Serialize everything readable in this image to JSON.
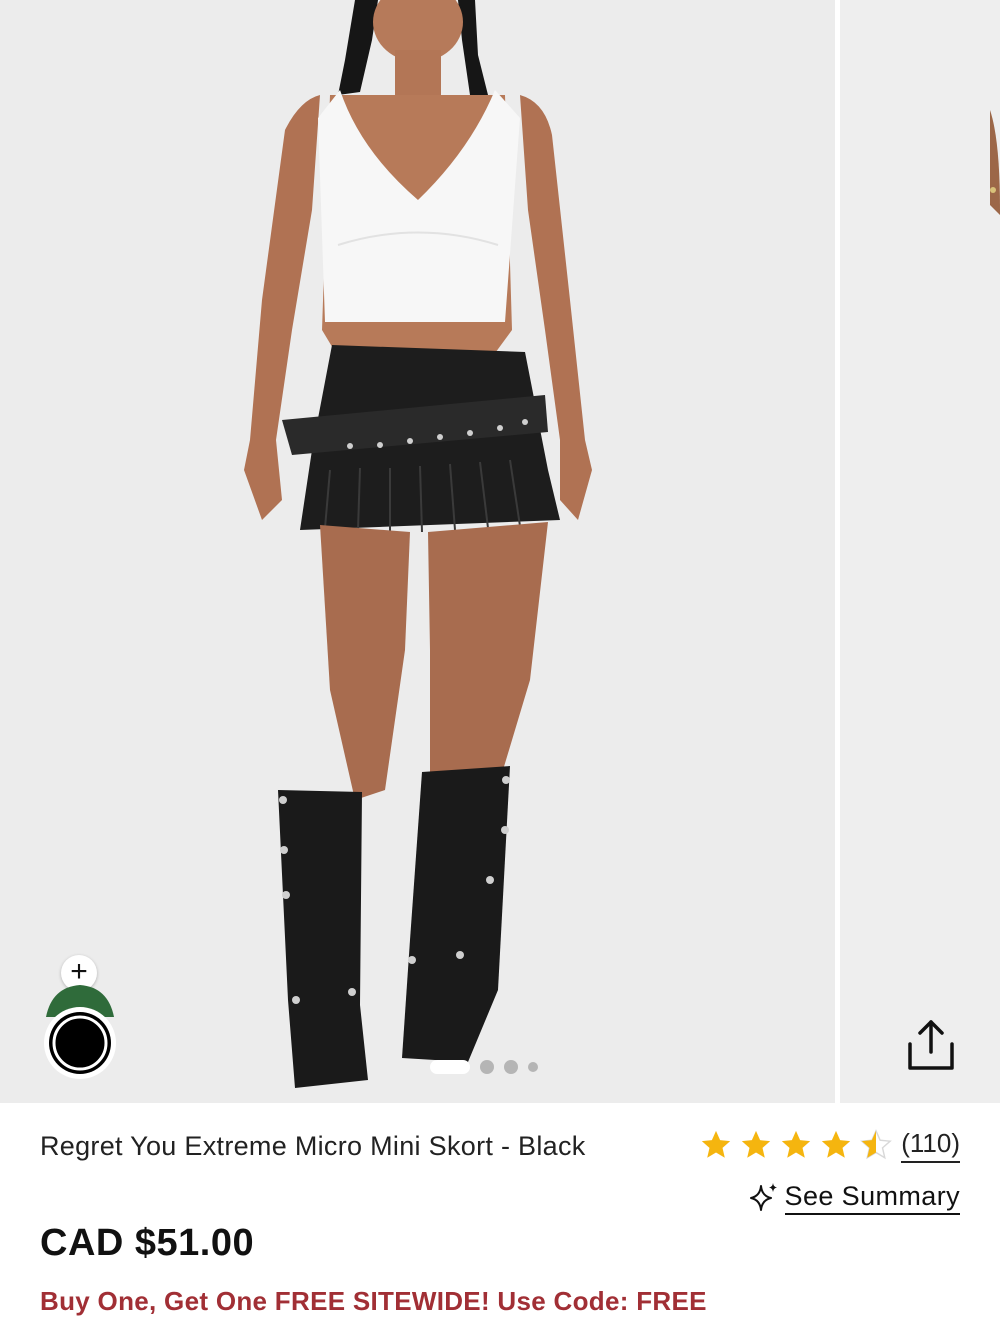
{
  "gallery": {
    "current_slide": 1,
    "total_slides": 4,
    "share_icon": "share-icon",
    "avatar_icon": "avatar-try-on-icon",
    "plus_label": "+"
  },
  "product": {
    "title": "Regret You Extreme Micro Mini Skort - Black",
    "price": "CAD $51.00",
    "promo": "Buy One, Get One FREE SITEWIDE! Use Code: FREE"
  },
  "rating": {
    "stars": 4.5,
    "count_label": "(110)",
    "star_color": "#f5b50f"
  },
  "summary": {
    "icon": "sparkle-icon",
    "label": "See Summary"
  },
  "colors": {
    "promo": "#a12f35",
    "avatar_green": "#2f6b3a"
  }
}
